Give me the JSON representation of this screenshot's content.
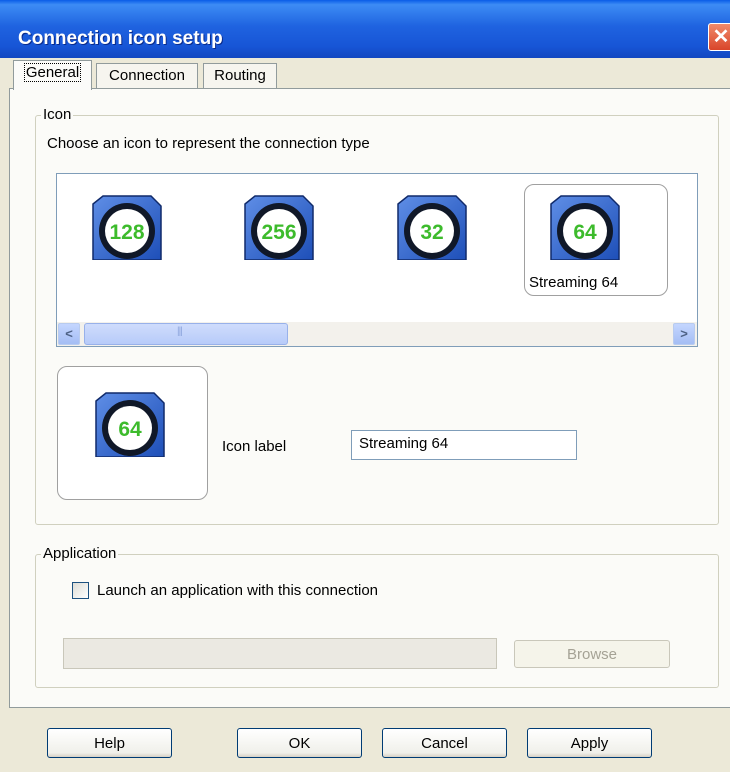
{
  "window": {
    "title": "Connection icon setup",
    "close_glyph": "✕"
  },
  "tabs": [
    {
      "label": "General",
      "active": true
    },
    {
      "label": "Connection",
      "active": false
    },
    {
      "label": "Routing",
      "active": false
    }
  ],
  "icon_group": {
    "legend": "Icon",
    "instruction": "Choose an icon to represent the connection type",
    "icons": [
      {
        "number": "128",
        "icon": "connection-128-icon"
      },
      {
        "number": "256",
        "icon": "connection-256-icon"
      },
      {
        "number": "32",
        "icon": "connection-32-icon"
      },
      {
        "number": "64",
        "icon": "connection-64-icon",
        "label": "Streaming 64",
        "selected": true
      }
    ],
    "scrollbar": {
      "left_arrow": "<",
      "right_arrow": ">",
      "grip": "|||"
    },
    "preview_number": "64",
    "label_caption": "Icon label",
    "label_value": "Streaming 64"
  },
  "application_group": {
    "legend": "Application",
    "checkbox_label": "Launch an application with this connection",
    "checked": false,
    "path_value": "",
    "browse_label": "Browse"
  },
  "buttons": {
    "help": "Help",
    "ok": "OK",
    "cancel": "Cancel",
    "apply": "Apply"
  },
  "colors": {
    "icon_green": "#3dbb2c",
    "icon_blue": "#1e4fb8",
    "title_bar": "#1f63e0"
  }
}
